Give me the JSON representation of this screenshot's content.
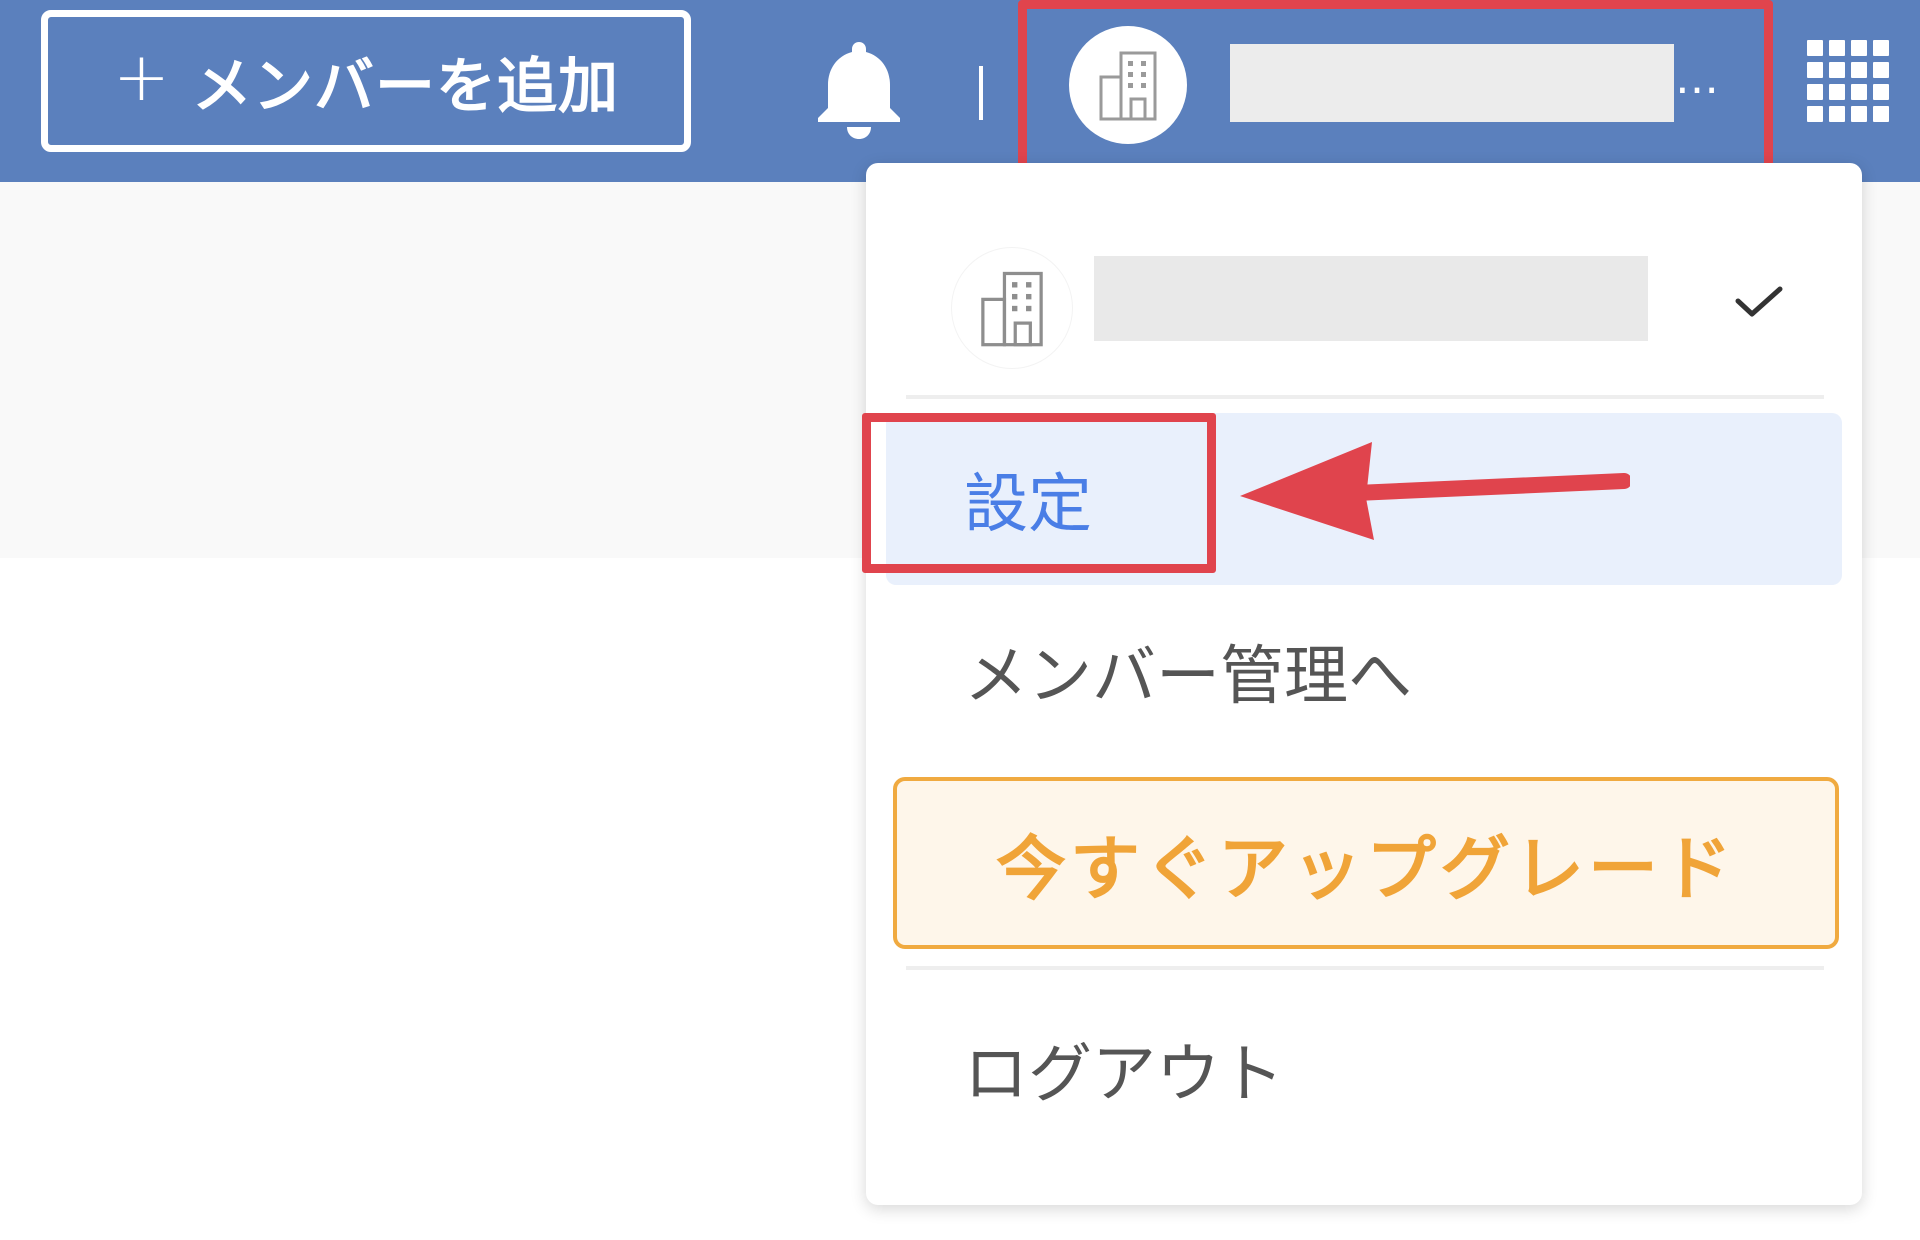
{
  "header": {
    "add_member_plus": "+",
    "add_member_label": "メンバーを追加",
    "notifications_icon": "bell-icon",
    "separator": "|",
    "account": {
      "avatar_icon": "building-icon",
      "name_redacted": true,
      "ellipsis": "…"
    },
    "apps_icon": "apps-grid-icon"
  },
  "dropdown": {
    "organization": {
      "icon": "building-icon",
      "name_redacted": true,
      "selected_icon": "check-icon"
    },
    "items": {
      "settings": "設定",
      "member_management": "メンバー管理へ",
      "upgrade": "今すぐアップグレード",
      "logout": "ログアウト"
    }
  },
  "colors": {
    "header_bg": "#5b80bd",
    "highlight_red": "#e0444d",
    "active_text": "#4a7ee6",
    "active_bg": "#e9f0fc",
    "upgrade_orange": "#f0a438",
    "upgrade_bg": "#fef6ea"
  }
}
